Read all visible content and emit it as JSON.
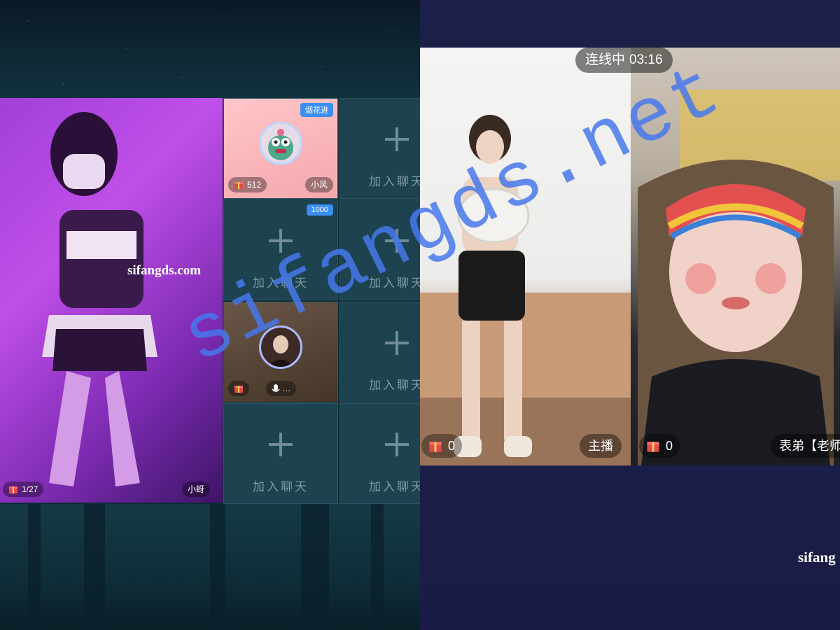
{
  "left_room": {
    "main_video": {
      "watermark": "sifangds.com",
      "gift_count": "1/27",
      "host_name": "小蚜"
    },
    "seats": [
      {
        "type": "occupied",
        "tag": "烟花进",
        "gift_count": "512",
        "name": "小风"
      },
      {
        "type": "empty",
        "join_label": "加入聊天"
      },
      {
        "type": "empty",
        "tag": "1000",
        "join_label": "加入聊天"
      },
      {
        "type": "empty",
        "join_label": "加入聊天"
      },
      {
        "type": "occupied-speaking",
        "status_text": "…"
      },
      {
        "type": "empty",
        "join_label": "加入聊天"
      },
      {
        "type": "empty",
        "join_label": "加入聊天"
      },
      {
        "type": "empty",
        "join_label": "加入聊天"
      }
    ]
  },
  "right_room": {
    "linking_label": "连线中",
    "linking_time": "03:16",
    "cam1": {
      "gift_count": "0",
      "role_label": "主播"
    },
    "cam2": {
      "gift_count": "0",
      "name": "表弟【老师"
    },
    "watermark": "sifang"
  },
  "overlay_watermark": "sifangds.net",
  "colors": {
    "left_bg": "#11313d",
    "seat_bg": "#1d4250",
    "right_bg": "#1f2150",
    "watermark_blue": "#4678eb",
    "tag_blue": "#3a8ff0"
  }
}
